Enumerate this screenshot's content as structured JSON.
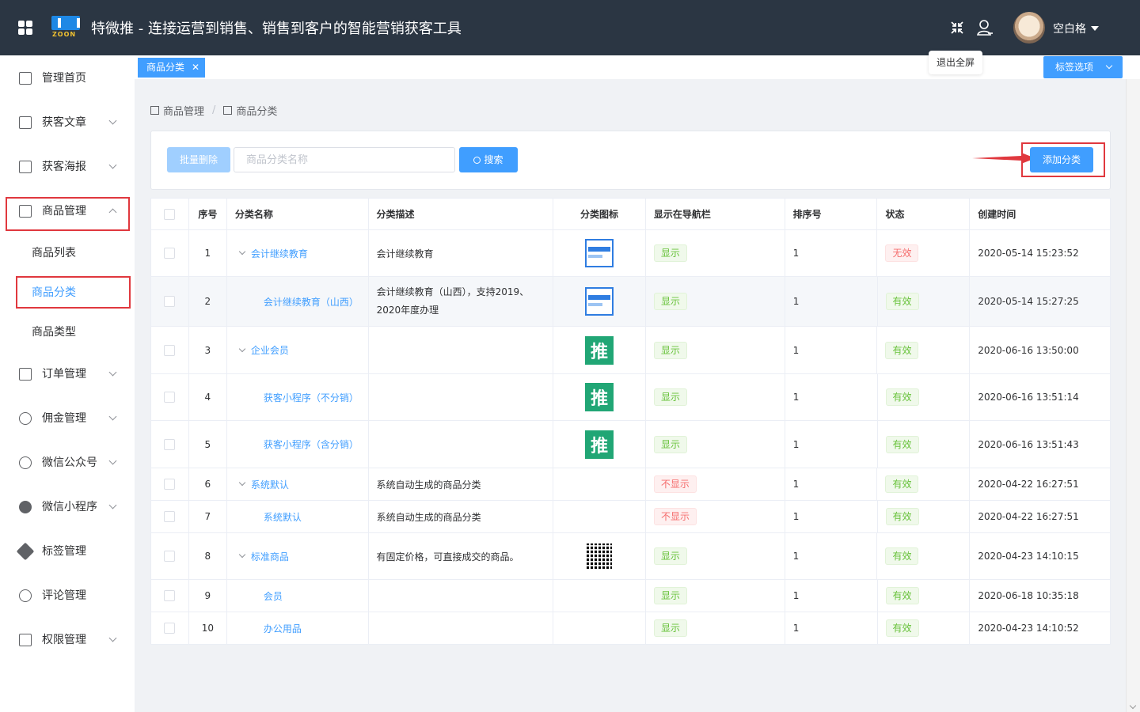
{
  "header": {
    "title": "特微推 - 连接运营到销售、销售到客户的智能营销获客工具",
    "logo_letters": "ZOON",
    "username": "空白格",
    "fullscreen_tooltip": "退出全屏"
  },
  "sidebar": {
    "items": [
      {
        "label": "管理首页",
        "icon": "home-icon"
      },
      {
        "label": "获客文章",
        "icon": "article-icon"
      },
      {
        "label": "获客海报",
        "icon": "poster-icon"
      },
      {
        "label": "商品管理",
        "icon": "goods-icon"
      },
      {
        "label": "订单管理",
        "icon": "order-icon"
      },
      {
        "label": "佣金管理",
        "icon": "commission-icon"
      },
      {
        "label": "微信公众号",
        "icon": "wechat-official-icon"
      },
      {
        "label": "微信小程序",
        "icon": "miniprogram-icon"
      },
      {
        "label": "标签管理",
        "icon": "tag-icon"
      },
      {
        "label": "评论管理",
        "icon": "comment-icon"
      },
      {
        "label": "权限管理",
        "icon": "permission-icon"
      }
    ],
    "sub_items": [
      "商品列表",
      "商品分类",
      "商品类型"
    ]
  },
  "tabs": {
    "active": "商品分类",
    "options_label": "标签选项"
  },
  "breadcrumb": [
    "商品管理",
    "商品分类"
  ],
  "toolbar": {
    "batch_delete": "批量删除",
    "search_placeholder": "商品分类名称",
    "search_label": "搜索",
    "add_label": "添加分类"
  },
  "table": {
    "headers": [
      "序号",
      "分类名称",
      "分类描述",
      "分类图标",
      "显示在导航栏",
      "排序号",
      "状态",
      "创建时间"
    ],
    "rows": [
      {
        "no": "1",
        "name": "会计继续教育",
        "desc": "会计继续教育",
        "icon": "course",
        "nav": "显示",
        "sort": "1",
        "status": "无效",
        "time": "2020-05-14 15:23:52"
      },
      {
        "no": "2",
        "name": "会计继续教育（山西）",
        "desc": "会计继续教育（山西），支持2019、2020年度办理",
        "icon": "course",
        "nav": "显示",
        "sort": "1",
        "status": "有效",
        "time": "2020-05-14 15:27:25"
      },
      {
        "no": "3",
        "name": "企业会员",
        "desc": "",
        "icon": "tui",
        "nav": "显示",
        "sort": "1",
        "status": "有效",
        "time": "2020-06-16 13:50:00"
      },
      {
        "no": "4",
        "name": "获客小程序（不分销）",
        "desc": "",
        "icon": "tui",
        "nav": "显示",
        "sort": "1",
        "status": "有效",
        "time": "2020-06-16 13:51:14"
      },
      {
        "no": "5",
        "name": "获客小程序（含分销）",
        "desc": "",
        "icon": "tui",
        "nav": "显示",
        "sort": "1",
        "status": "有效",
        "time": "2020-06-16 13:51:43"
      },
      {
        "no": "6",
        "name": "系统默认",
        "desc": "系统自动生成的商品分类",
        "icon": "",
        "nav": "不显示",
        "sort": "1",
        "status": "有效",
        "time": "2020-04-22 16:27:51"
      },
      {
        "no": "7",
        "name": "系统默认",
        "desc": "系统自动生成的商品分类",
        "icon": "",
        "nav": "不显示",
        "sort": "1",
        "status": "有效",
        "time": "2020-04-22 16:27:51"
      },
      {
        "no": "8",
        "name": "标准商品",
        "desc": "有固定价格，可直接成交的商品。",
        "icon": "qr",
        "nav": "显示",
        "sort": "1",
        "status": "有效",
        "time": "2020-04-23 14:10:15"
      },
      {
        "no": "9",
        "name": "会员",
        "desc": "",
        "icon": "",
        "nav": "显示",
        "sort": "1",
        "status": "有效",
        "time": "2020-06-18 10:35:18"
      },
      {
        "no": "10",
        "name": "办公用品",
        "desc": "",
        "icon": "",
        "nav": "显示",
        "sort": "1",
        "status": "有效",
        "time": "2020-04-23 14:10:52"
      }
    ],
    "thumb_text": "推"
  },
  "colors": {
    "header_bg": "#2b3643",
    "primary": "#409eff",
    "success": "#67c23a",
    "danger": "#f56c6c",
    "highlight_box": "#e0383e"
  }
}
